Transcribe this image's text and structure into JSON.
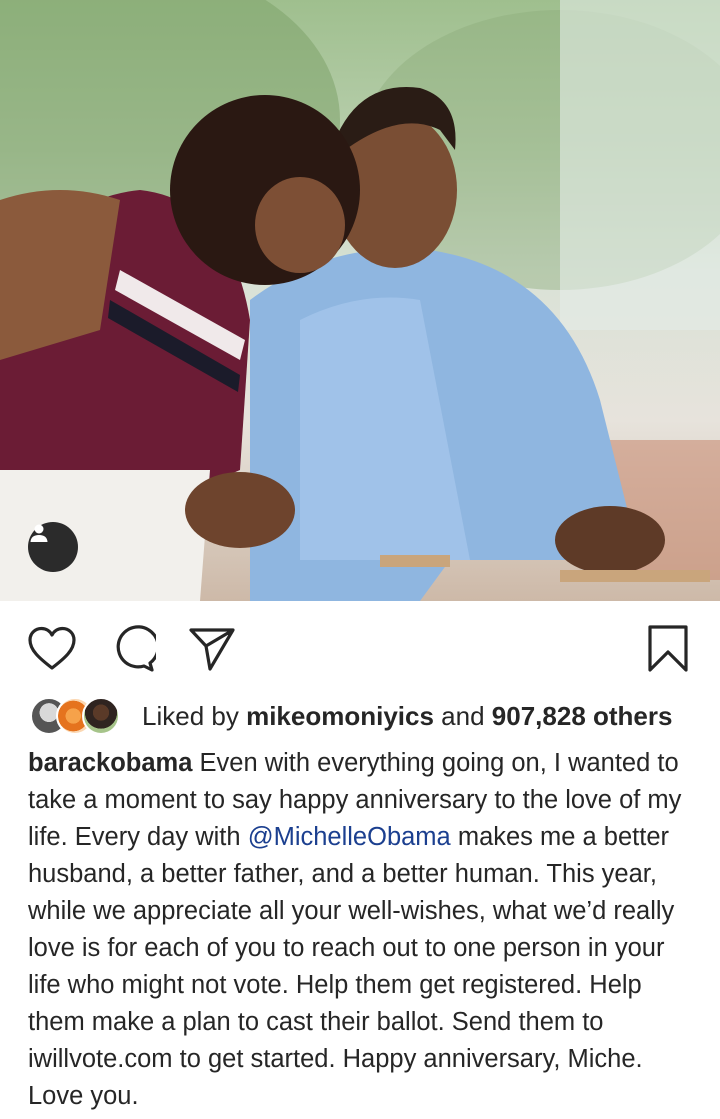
{
  "post": {
    "photo_alt": "Photo",
    "tag_icon": "person-icon"
  },
  "actions": {
    "like_icon": "heart-icon",
    "comment_icon": "comment-icon",
    "share_icon": "send-icon",
    "save_icon": "bookmark-icon"
  },
  "likes": {
    "prefix": "Liked by",
    "user": "mikeomoniyics",
    "middle": "and",
    "count": "907,828 others"
  },
  "caption": {
    "username": "barackobama",
    "text_before": "Even with everything going on, I wanted to take a moment to say happy anniversary to the love of my life. Every day with",
    "mention": "@MichelleObama",
    "text_after": "makes me a better husband, a better father, and a better human. This year, while we appreciate all your well-wishes, what we’d really love is for each of you to reach out to one person in your life who might not vote. Help them get registered. Help them make a plan to cast their ballot. Send them to iwillvote.com to get started. Happy anniversary, Miche. Love you."
  },
  "colors": {
    "text": "#262626",
    "mention": "#1b3f8f",
    "badge": "#2b2b2b"
  }
}
